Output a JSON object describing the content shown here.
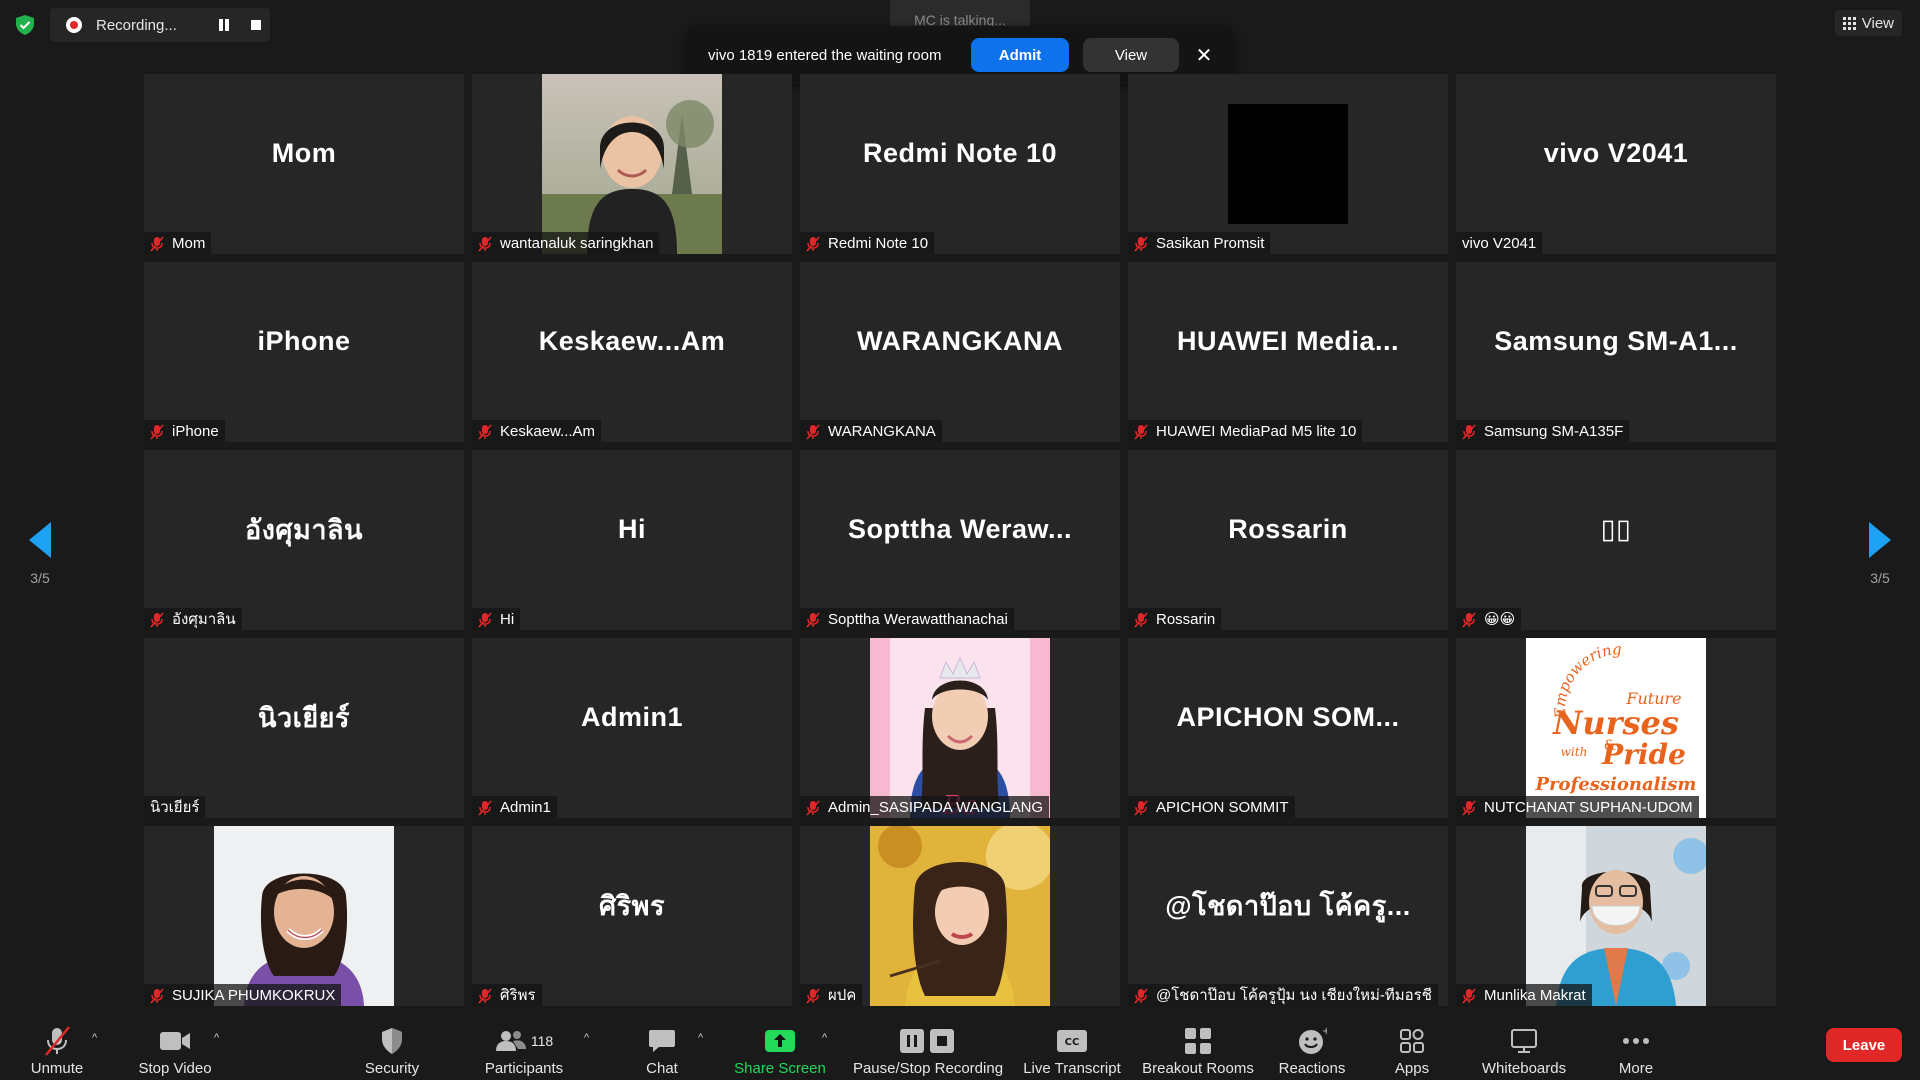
{
  "top": {
    "recording_label": "Recording...",
    "talking": "MC is talking...",
    "waiting_message": "vivo 1819 entered the waiting room",
    "admit_label": "Admit",
    "view_label": "View",
    "close_glyph": "✕",
    "layout_view_label": "View"
  },
  "nav": {
    "page_left": "3/5",
    "page_right": "3/5"
  },
  "tiles": [
    {
      "display": "Mom",
      "label": "Mom",
      "muted": true,
      "kind": "name"
    },
    {
      "display": "",
      "label": "wantanaluk saringkhan",
      "muted": true,
      "kind": "photo-woman-field"
    },
    {
      "display": "Redmi Note 10",
      "label": "Redmi Note 10",
      "muted": true,
      "kind": "name"
    },
    {
      "display": "",
      "label": "Sasikan Promsit",
      "muted": true,
      "kind": "black"
    },
    {
      "display": "vivo V2041",
      "label": "vivo V2041",
      "muted": false,
      "kind": "name"
    },
    {
      "display": "iPhone",
      "label": "iPhone",
      "muted": true,
      "kind": "name"
    },
    {
      "display": "Keskaew...Am",
      "label": "Keskaew...Am",
      "muted": true,
      "kind": "name"
    },
    {
      "display": "WARANGKANA",
      "label": "WARANGKANA",
      "muted": true,
      "kind": "name"
    },
    {
      "display": "HUAWEI  Media...",
      "label": "HUAWEI MediaPad M5 lite 10",
      "muted": true,
      "kind": "name"
    },
    {
      "display": "Samsung  SM-A1...",
      "label": "Samsung SM-A135F",
      "muted": true,
      "kind": "name"
    },
    {
      "display": "อังศุมาลิน",
      "label": "อังศุมาลิน",
      "muted": true,
      "kind": "name"
    },
    {
      "display": "Hi",
      "label": "Hi",
      "muted": true,
      "kind": "name"
    },
    {
      "display": "Sopttha  Weraw...",
      "label": "Sopttha Werawatthanachai",
      "muted": true,
      "kind": "name"
    },
    {
      "display": "Rossarin",
      "label": "Rossarin",
      "muted": true,
      "kind": "name"
    },
    {
      "display": "▯▯",
      "label": "😀😀",
      "muted": true,
      "kind": "name"
    },
    {
      "display": "นิวเยียร์",
      "label": "นิวเยียร์",
      "muted": false,
      "kind": "name"
    },
    {
      "display": "Admin1",
      "label": "Admin1",
      "muted": true,
      "kind": "name"
    },
    {
      "display": "",
      "label": "Admin_SASIPADA WANGLANG",
      "muted": true,
      "kind": "photo-girl-crown"
    },
    {
      "display": "APICHON  SOM...",
      "label": "APICHON SOMMIT",
      "muted": true,
      "kind": "name"
    },
    {
      "display": "",
      "label": "NUTCHANAT SUPHAN-UDOM",
      "muted": true,
      "kind": "logo-nurses",
      "logo_lines": [
        "Empowering",
        "Future",
        "Nurses",
        "with",
        "&",
        "Pride",
        "Professionalism"
      ]
    },
    {
      "display": "",
      "label": "SUJIKA PHUMKOKRUX",
      "muted": true,
      "kind": "photo-woman-studio"
    },
    {
      "display": "ศิริพร",
      "label": "ศิริพร",
      "muted": true,
      "kind": "name"
    },
    {
      "display": "",
      "label": "ผปค",
      "muted": true,
      "kind": "photo-girl-yellow"
    },
    {
      "display": "@โชดาป๊อบ  โค้ครู...",
      "label": "@โชดาป๊อบ โค้ครูปุ้ม นง เชียงใหม่-ทีมอรชี",
      "muted": true,
      "kind": "name"
    },
    {
      "display": "",
      "label": "Munlika Makrat",
      "muted": true,
      "kind": "photo-woman-mask"
    }
  ],
  "toolbar": {
    "unmute": "Unmute",
    "stop_video": "Stop Video",
    "security": "Security",
    "participants": "Participants",
    "participants_count": "118",
    "chat": "Chat",
    "share_screen": "Share Screen",
    "pause_stop_recording": "Pause/Stop Recording",
    "live_transcript": "Live Transcript",
    "breakout_rooms": "Breakout Rooms",
    "reactions": "Reactions",
    "apps": "Apps",
    "whiteboards": "Whiteboards",
    "more": "More",
    "leave": "Leave"
  },
  "colors": {
    "background": "#1a1a1a",
    "tile": "#262626",
    "accent_blue": "#0e72ed",
    "share_green": "#23d959",
    "leave_red": "#e02828",
    "mute_red": "#e02828",
    "nav_arrow": "#1da1f2"
  }
}
